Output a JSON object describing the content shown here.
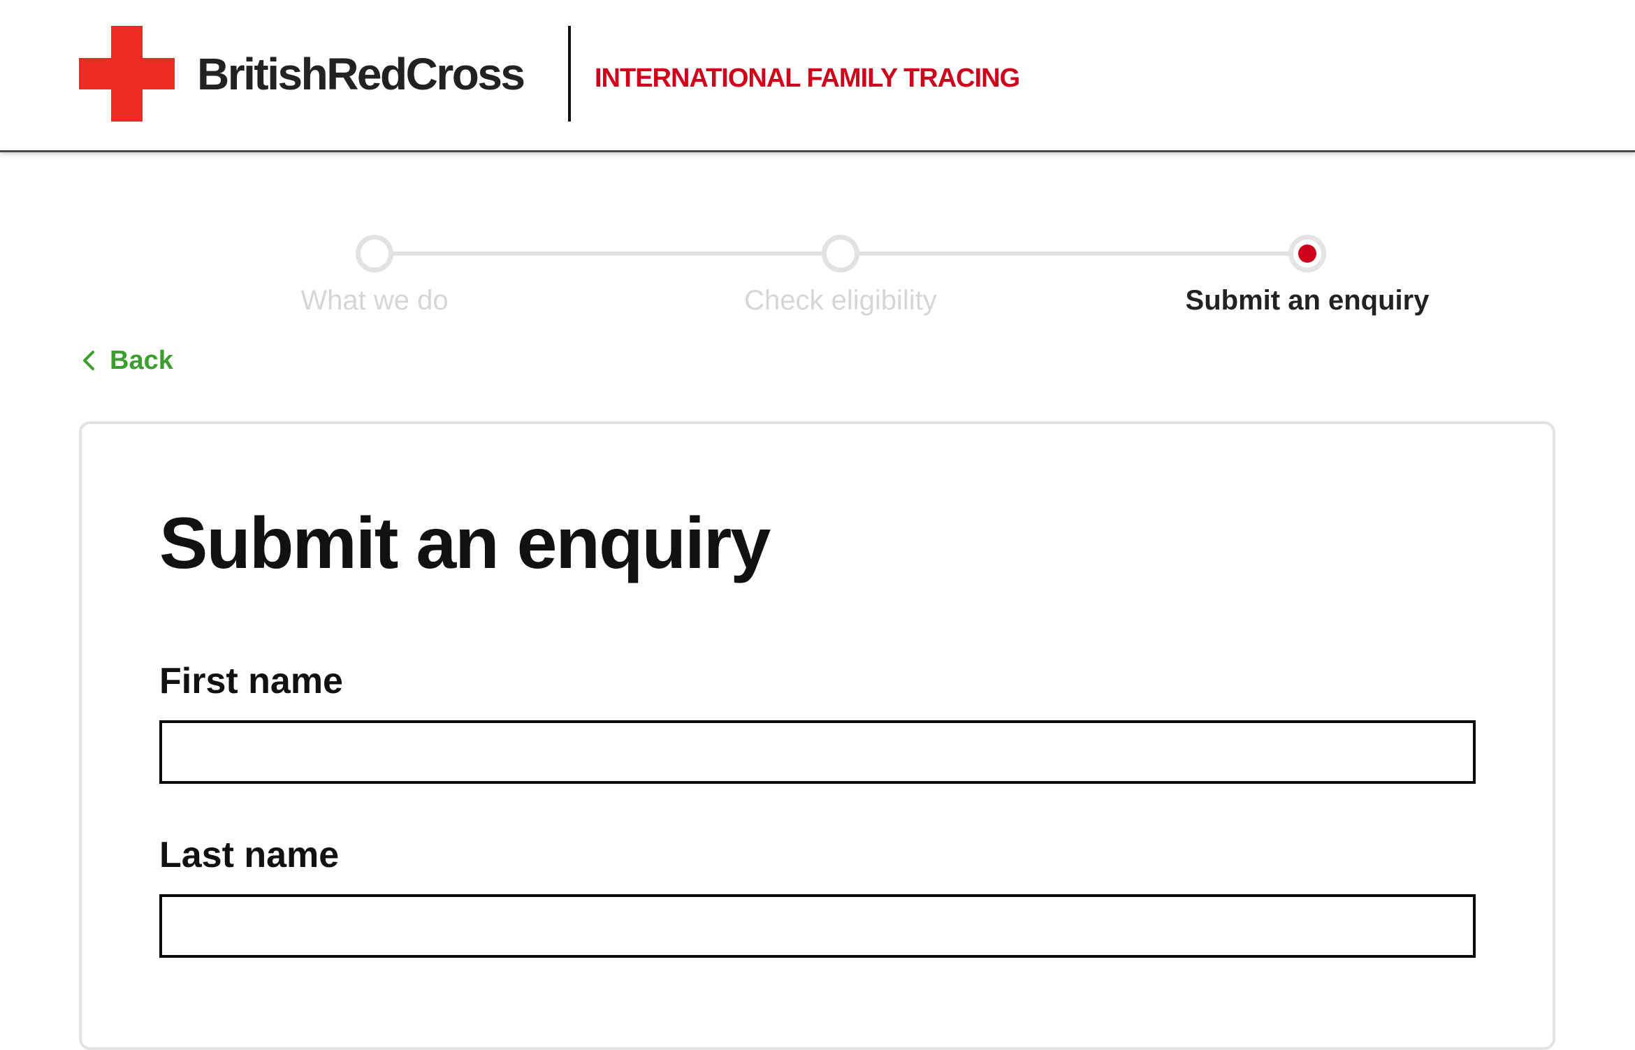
{
  "header": {
    "logo_text": "BritishRedCross",
    "service_name": "INTERNATIONAL FAMILY TRACING"
  },
  "stepper": {
    "steps": [
      {
        "label": "What we do",
        "state": "inactive"
      },
      {
        "label": "Check eligibility",
        "state": "inactive"
      },
      {
        "label": "Submit an enquiry",
        "state": "active"
      }
    ],
    "current_step": 3
  },
  "back_link": {
    "label": "Back",
    "icon": "chevron-left-icon"
  },
  "form": {
    "title": "Submit an enquiry",
    "fields": [
      {
        "label": "First name",
        "value": "",
        "placeholder": ""
      },
      {
        "label": "Last name",
        "value": "",
        "placeholder": ""
      }
    ]
  },
  "colors": {
    "brand_red": "#ee2a24",
    "service_red": "#d0021b",
    "link_green": "#3c9f2d",
    "inactive_grey": "#d6d6d6"
  }
}
